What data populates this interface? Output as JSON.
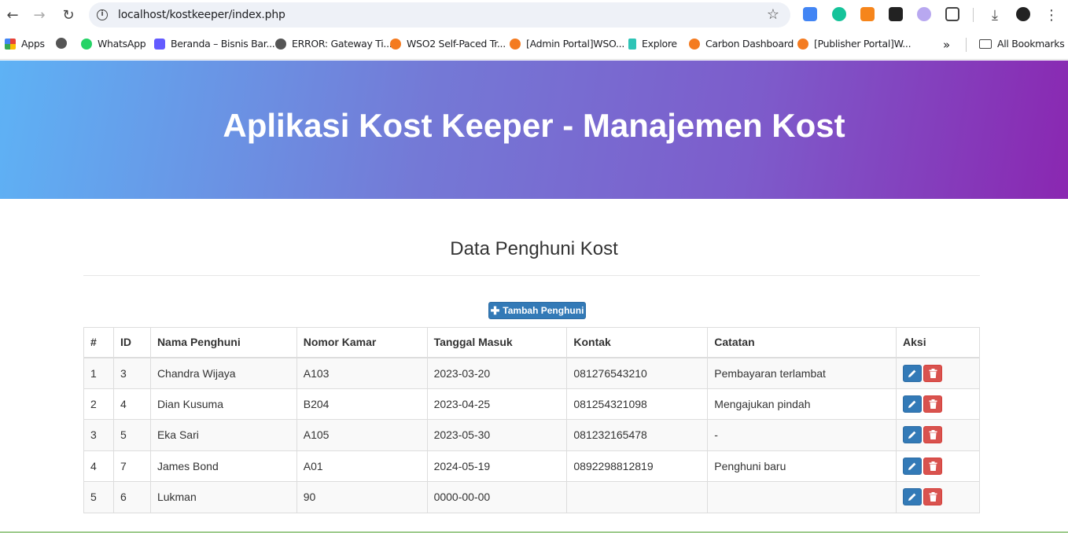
{
  "browser": {
    "url": "localhost/kostkeeper/index.php",
    "bookmarks": [
      {
        "label": "Apps",
        "color": "#e94235"
      },
      {
        "label": "",
        "color": "#555555"
      },
      {
        "label": "WhatsApp",
        "color": "#25d366"
      },
      {
        "label": "Beranda – Bisnis Bar...",
        "color": "#635bff"
      },
      {
        "label": "ERROR: Gateway Ti...",
        "color": "#555555"
      },
      {
        "label": "WSO2 Self-Paced Tr...",
        "color": "#f47b20"
      },
      {
        "label": "[Admin Portal]WSO...",
        "color": "#f47b20"
      },
      {
        "label": "Explore",
        "color": "#2ec4b6"
      },
      {
        "label": "Carbon Dashboard",
        "color": "#f47b20"
      },
      {
        "label": "[Publisher Portal]W...",
        "color": "#f47b20"
      }
    ],
    "all_bookmarks": "All Bookmarks",
    "more": "»"
  },
  "header": {
    "title": "Aplikasi Kost Keeper - Manajemen Kost"
  },
  "main": {
    "section_title": "Data Penghuni Kost",
    "add_button": "Tambah Penghuni",
    "columns": [
      "#",
      "ID",
      "Nama Penghuni",
      "Nomor Kamar",
      "Tanggal Masuk",
      "Kontak",
      "Catatan",
      "Aksi"
    ],
    "rows": [
      {
        "no": "1",
        "id": "3",
        "nama": "Chandra Wijaya",
        "kamar": "A103",
        "tanggal": "2023-03-20",
        "kontak": "081276543210",
        "catatan": "Pembayaran terlambat"
      },
      {
        "no": "2",
        "id": "4",
        "nama": "Dian Kusuma",
        "kamar": "B204",
        "tanggal": "2023-04-25",
        "kontak": "081254321098",
        "catatan": "Mengajukan pindah"
      },
      {
        "no": "3",
        "id": "5",
        "nama": "Eka Sari",
        "kamar": "A105",
        "tanggal": "2023-05-30",
        "kontak": "081232165478",
        "catatan": "-"
      },
      {
        "no": "4",
        "id": "7",
        "nama": "James Bond",
        "kamar": "A01",
        "tanggal": "2024-05-19",
        "kontak": "0892298812819",
        "catatan": "Penghuni baru"
      },
      {
        "no": "5",
        "id": "6",
        "nama": "Lukman",
        "kamar": "90",
        "tanggal": "0000-00-00",
        "kontak": "",
        "catatan": ""
      }
    ]
  },
  "colors": {
    "primary": "#337ab7",
    "danger": "#d9534f",
    "gradient_start": "#5eb2f5",
    "gradient_end": "#8a27b1"
  }
}
